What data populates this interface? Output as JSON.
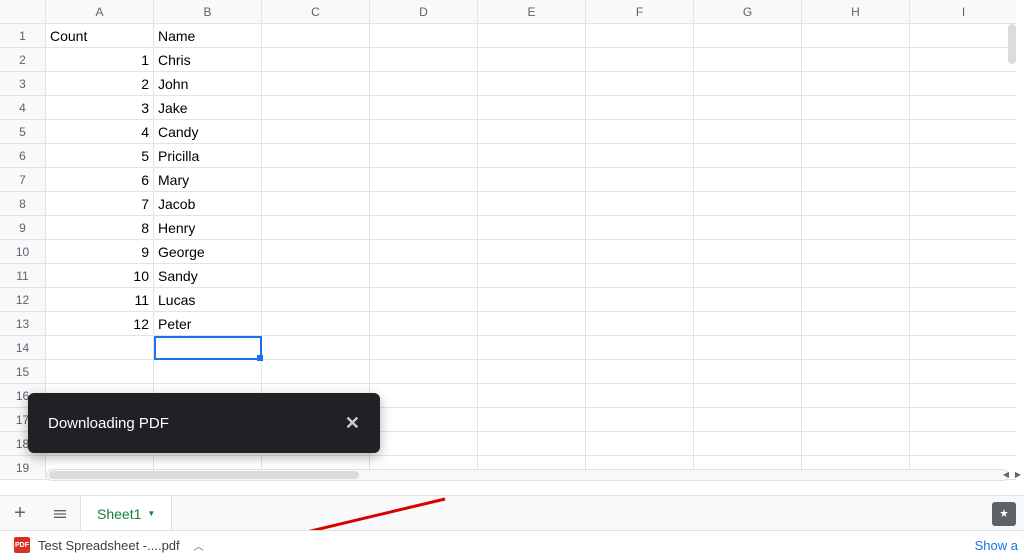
{
  "columns": [
    "A",
    "B",
    "C",
    "D",
    "E",
    "F",
    "G",
    "H",
    "I"
  ],
  "row_numbers": [
    1,
    2,
    3,
    4,
    5,
    6,
    7,
    8,
    9,
    10,
    11,
    12,
    13,
    14,
    15,
    16,
    17,
    18,
    19
  ],
  "header_row": {
    "A": "Count",
    "B": "Name"
  },
  "data_rows": [
    {
      "A": "1",
      "B": "Chris"
    },
    {
      "A": "2",
      "B": "John"
    },
    {
      "A": "3",
      "B": "Jake"
    },
    {
      "A": "4",
      "B": "Candy"
    },
    {
      "A": "5",
      "B": "Pricilla"
    },
    {
      "A": "6",
      "B": "Mary"
    },
    {
      "A": "7",
      "B": "Jacob"
    },
    {
      "A": "8",
      "B": "Henry"
    },
    {
      "A": "9",
      "B": "George"
    },
    {
      "A": "10",
      "B": "Sandy"
    },
    {
      "A": "11",
      "B": "Lucas"
    },
    {
      "A": "12",
      "B": "Peter"
    }
  ],
  "selected_cell": "B14",
  "toast": {
    "message": "Downloading PDF",
    "close": "✕"
  },
  "sheet_bar": {
    "add": "+",
    "tab_name": "Sheet1"
  },
  "download": {
    "filename": "Test Spreadsheet -....pdf",
    "icon_label": "PDF",
    "show_all": "Show a"
  }
}
